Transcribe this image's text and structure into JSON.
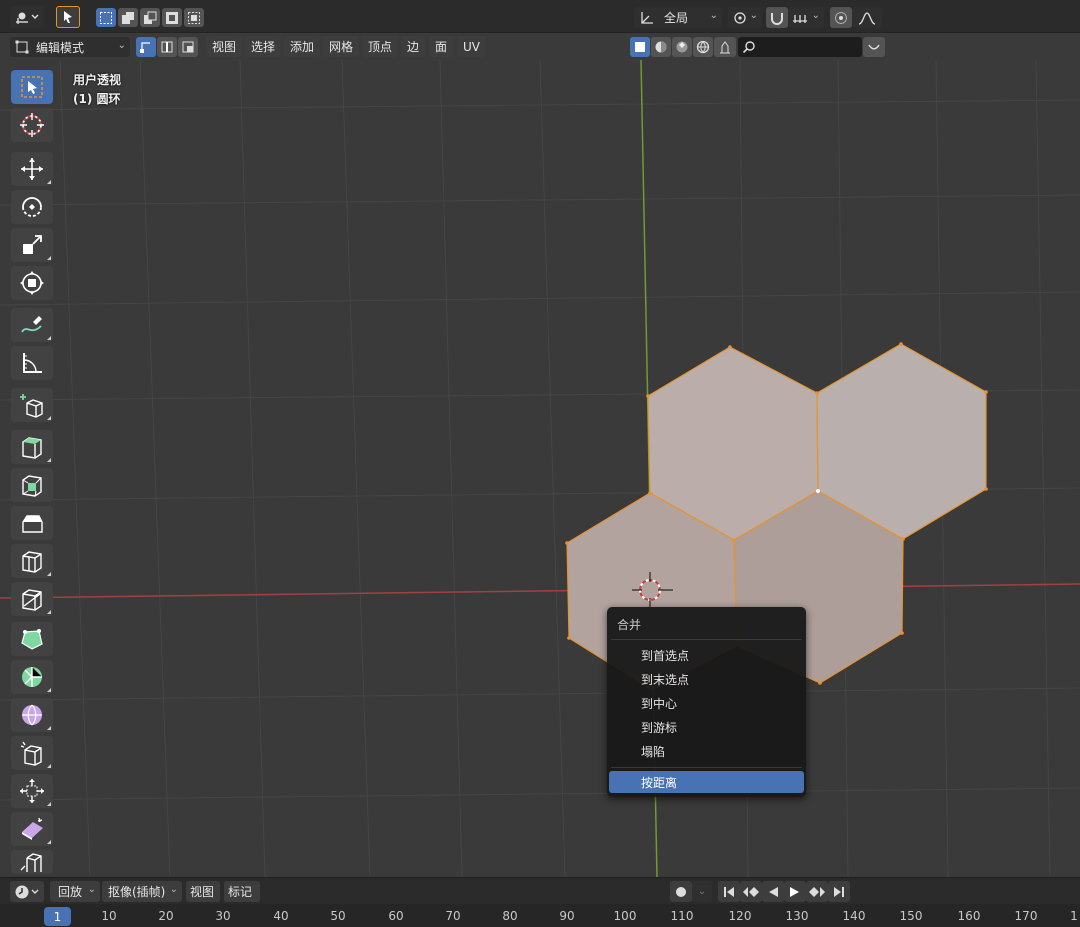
{
  "colors": {
    "accent": "#4772b3",
    "selection_orange": "#e8922d",
    "face_fill": "#b8a8a4",
    "axis_x": "#c64a4a",
    "axis_y": "#7fb03a"
  },
  "header": {
    "editor_icon": "editor-type-icon",
    "transform_orientation": "全局",
    "mode": "编辑模式",
    "menus": [
      "视图",
      "选择",
      "添加",
      "网格",
      "顶点",
      "边",
      "面",
      "UV"
    ],
    "search_placeholder": ""
  },
  "viewport": {
    "view_name": "用户透视",
    "object_name": "(1) 圆环"
  },
  "toolbar": {
    "tools": [
      "select-box-icon",
      "cursor-icon",
      "move-icon",
      "rotate-icon",
      "scale-icon",
      "transform-icon",
      "annotate-icon",
      "measure-icon",
      "add-cube-icon",
      "extrude-icon",
      "inset-icon",
      "bevel-icon",
      "loop-cut-icon",
      "knife-icon",
      "poly-build-icon",
      "spin-icon",
      "smooth-icon",
      "edge-slide-icon",
      "shrink-fatten-icon",
      "shear-icon",
      "rip-icon"
    ]
  },
  "context_menu": {
    "title": "合并",
    "items": [
      "到首选点",
      "到末选点",
      "到中心",
      "到游标",
      "塌陷"
    ],
    "selected_item": "按距离"
  },
  "timeline": {
    "playback_label": "回放",
    "keying_label": "抠像(插帧)",
    "view_label": "视图",
    "marker_label": "标记",
    "current_frame": "1",
    "ticks": [
      "10",
      "20",
      "30",
      "40",
      "50",
      "60",
      "70",
      "80",
      "90",
      "100",
      "110",
      "120",
      "130",
      "140",
      "150",
      "160",
      "170",
      "1"
    ]
  }
}
